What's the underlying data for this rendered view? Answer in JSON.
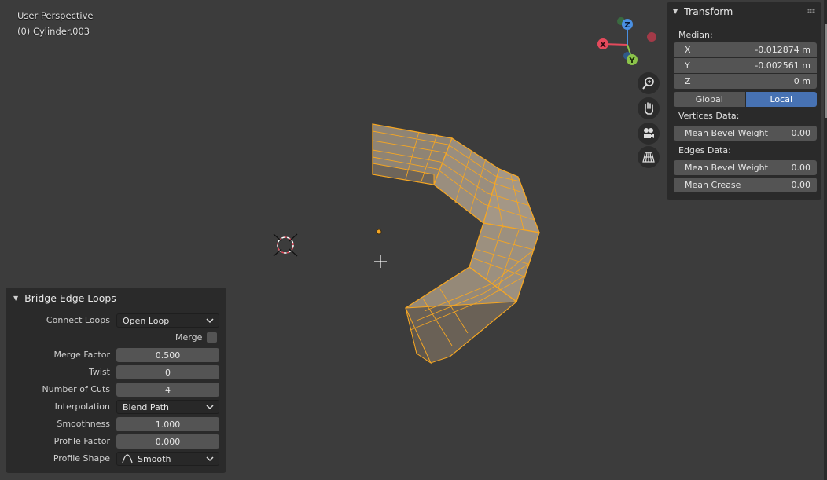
{
  "viewport": {
    "title": "User Perspective",
    "object": "(0) Cylinder.003",
    "axes": {
      "x": "X",
      "y": "Y",
      "z": "Z"
    },
    "nav_icons": [
      "zoom-icon",
      "hand-pan-icon",
      "camera-icon",
      "grid-perspective-icon"
    ]
  },
  "transform_panel": {
    "title": "Transform",
    "median_label": "Median:",
    "x": {
      "label": "X",
      "value": "-0.012874 m"
    },
    "y": {
      "label": "Y",
      "value": "-0.002561 m"
    },
    "z": {
      "label": "Z",
      "value": "0 m"
    },
    "global_label": "Global",
    "local_label": "Local",
    "vertices_label": "Vertices Data:",
    "vert_bevel": {
      "label": "Mean Bevel Weight",
      "value": "0.00"
    },
    "edges_label": "Edges Data:",
    "edge_bevel": {
      "label": "Mean Bevel Weight",
      "value": "0.00"
    },
    "edge_crease": {
      "label": "Mean Crease",
      "value": "0.00"
    }
  },
  "bridge_panel": {
    "title": "Bridge Edge Loops",
    "connect_loops": {
      "label": "Connect Loops",
      "value": "Open Loop"
    },
    "merge": {
      "label": "Merge",
      "checked": false
    },
    "merge_factor": {
      "label": "Merge Factor",
      "value": "0.500"
    },
    "twist": {
      "label": "Twist",
      "value": "0"
    },
    "number_of_cuts": {
      "label": "Number of Cuts",
      "value": "4"
    },
    "interpolation": {
      "label": "Interpolation",
      "value": "Blend Path"
    },
    "smoothness": {
      "label": "Smoothness",
      "value": "1.000"
    },
    "profile_factor": {
      "label": "Profile Factor",
      "value": "0.000"
    },
    "profile_shape": {
      "label": "Profile Shape",
      "value": "Smooth"
    }
  },
  "colors": {
    "accent": "#4772b3",
    "selection": "#f5a623",
    "axis_x": "#e44a5c",
    "axis_y": "#8bc34a",
    "axis_z": "#4a90e2"
  }
}
